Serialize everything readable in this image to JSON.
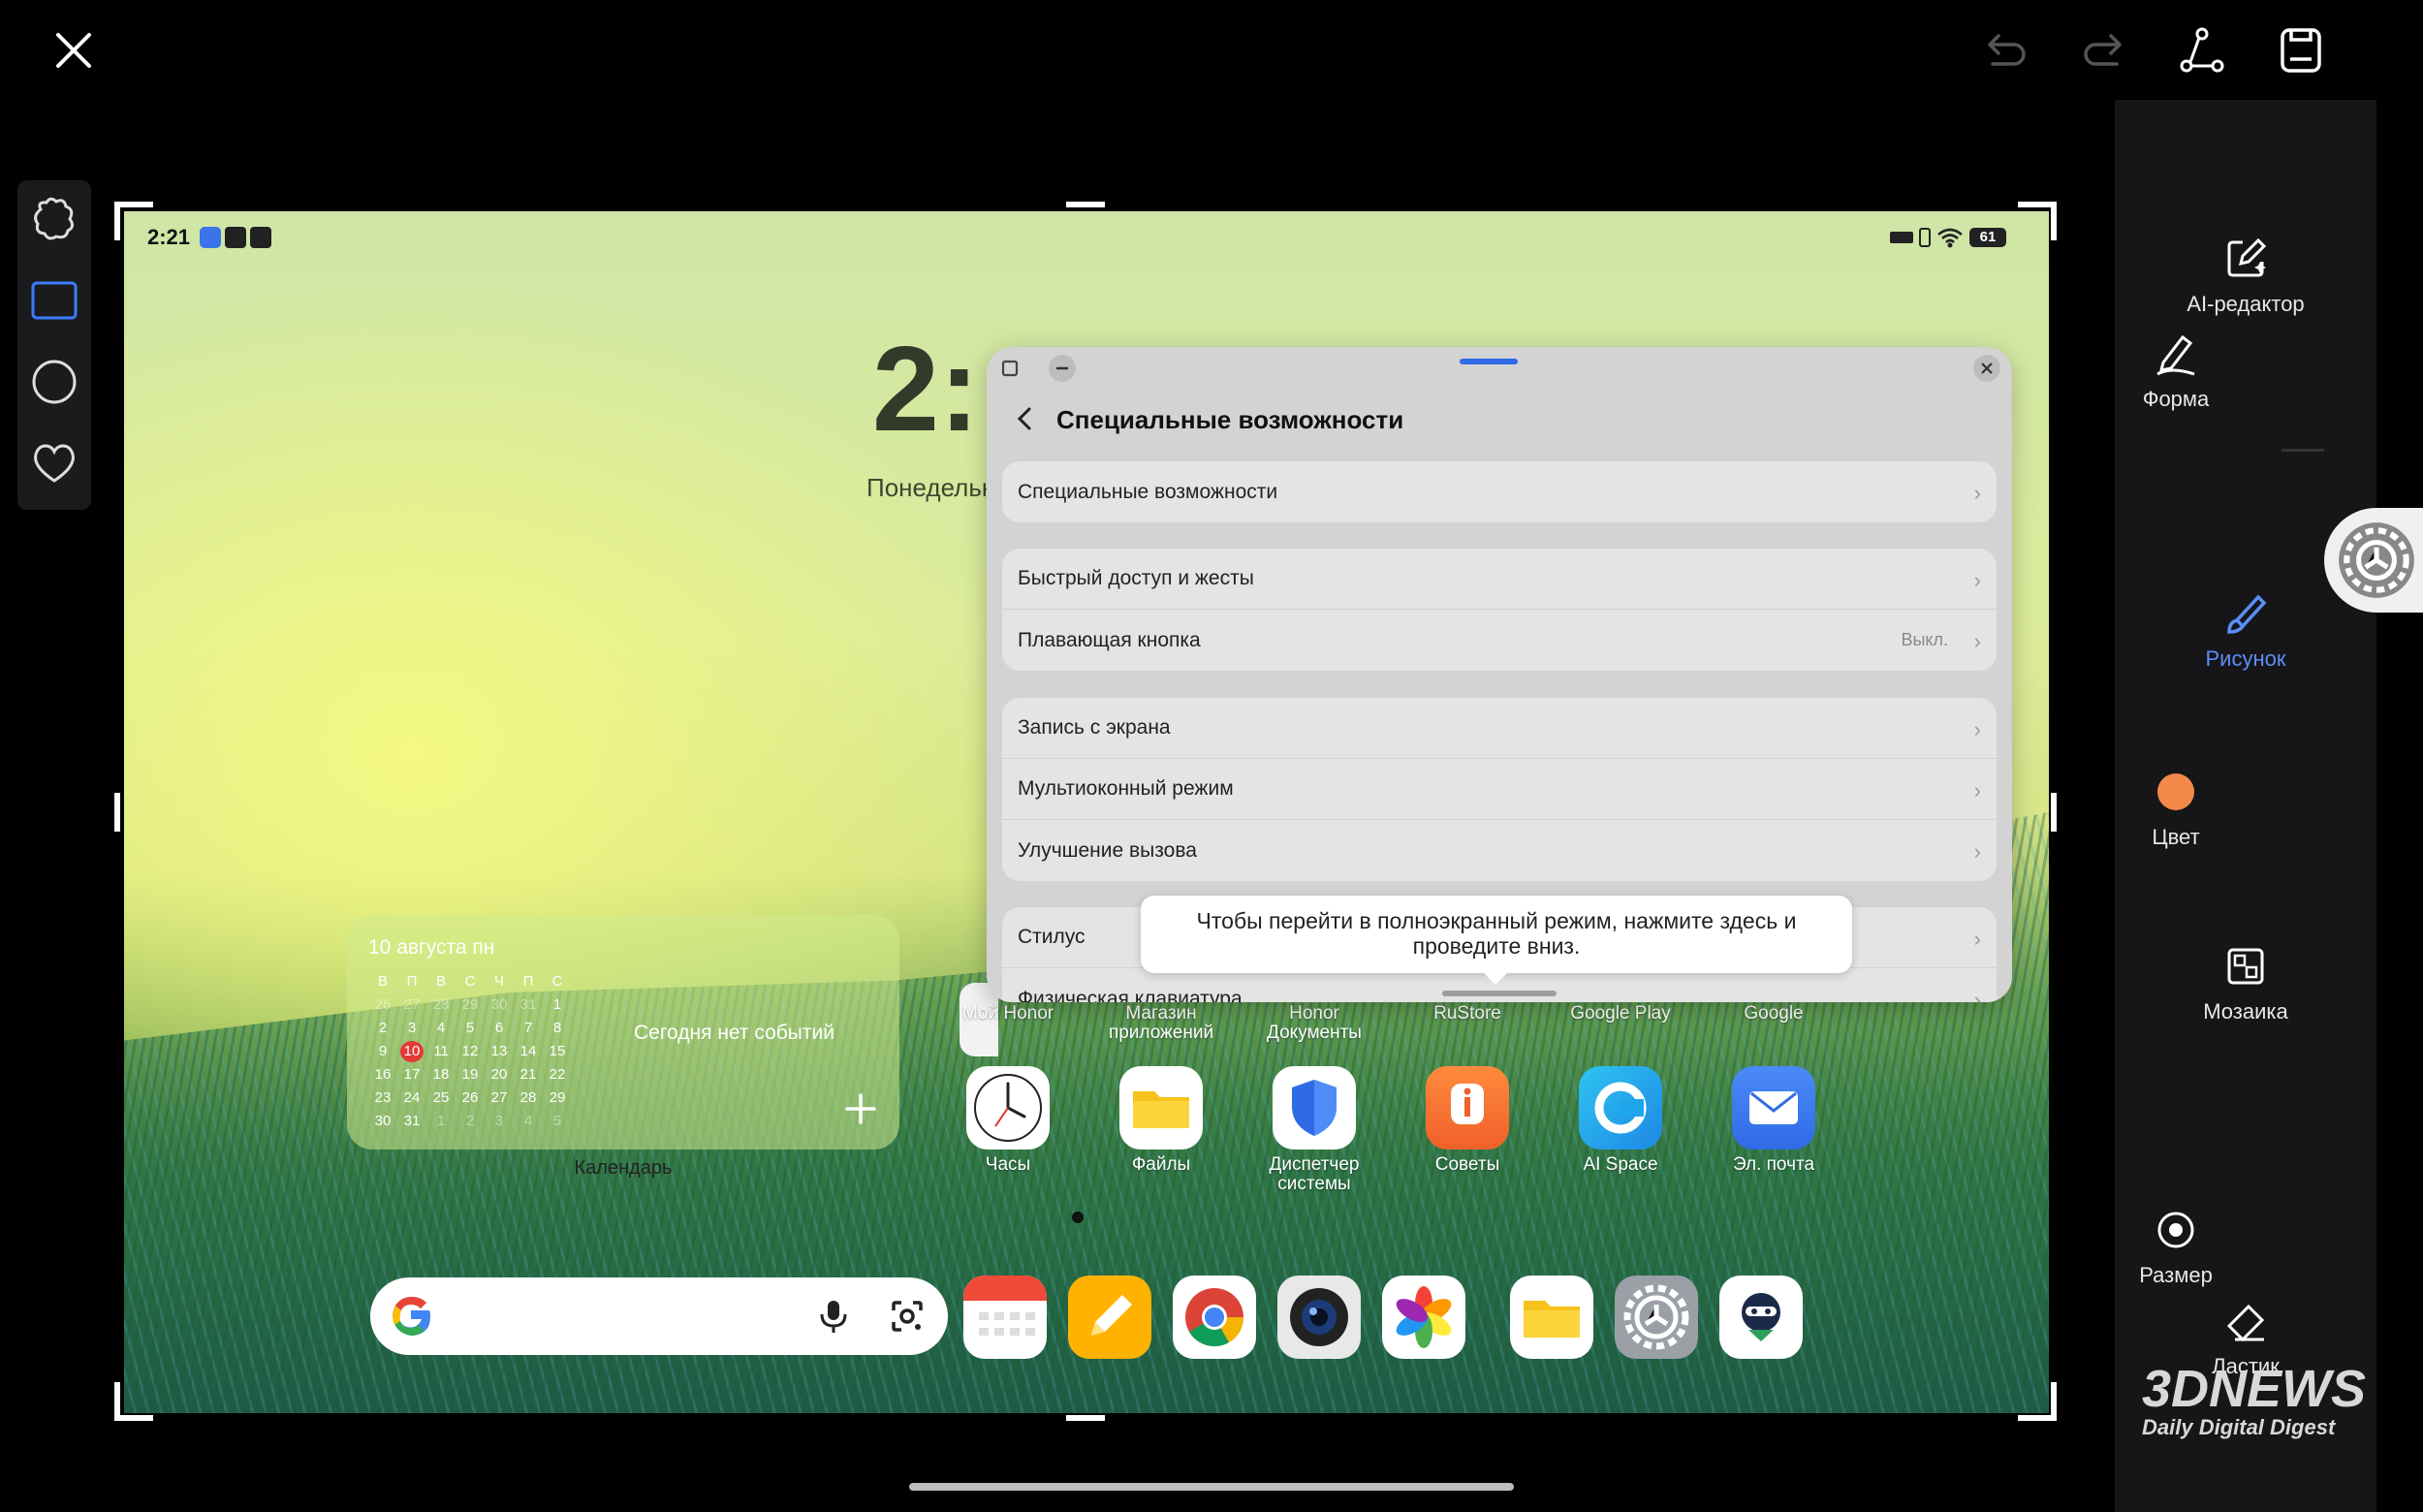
{
  "toolbar": {
    "close": "close-icon",
    "undo": "undo-icon",
    "redo": "redo-icon",
    "path": "path-icon",
    "save": "save-icon"
  },
  "shapes": [
    "puzzle-icon",
    "rectangle-icon",
    "circle-icon",
    "heart-icon"
  ],
  "tools": {
    "ai_editor": "AI-редактор",
    "shape": "Форма",
    "drawing": "Рисунок",
    "color": "Цвет",
    "color_value": "#f5894a",
    "mosaic": "Мозаика",
    "size": "Размер",
    "eraser": "Ластик"
  },
  "accent": "#5b8ef7",
  "status_bar": {
    "time": "2:21",
    "battery": "61"
  },
  "home": {
    "big_clock": "2:",
    "date_partial": "Понедельн"
  },
  "calendar": {
    "header": "10 августа пн",
    "weekdays": [
      "В",
      "П",
      "В",
      "С",
      "Ч",
      "П",
      "С"
    ],
    "weeks": [
      [
        "26",
        "27",
        "28",
        "29",
        "30",
        "31",
        "1"
      ],
      [
        "2",
        "3",
        "4",
        "5",
        "6",
        "7",
        "8"
      ],
      [
        "9",
        "10",
        "11",
        "12",
        "13",
        "14",
        "15"
      ],
      [
        "16",
        "17",
        "18",
        "19",
        "20",
        "21",
        "22"
      ],
      [
        "23",
        "24",
        "25",
        "26",
        "27",
        "28",
        "29"
      ],
      [
        "30",
        "31",
        "1",
        "2",
        "3",
        "4",
        "5"
      ]
    ],
    "no_events": "Сегодня нет событий",
    "label": "Календарь"
  },
  "folders_row": [
    {
      "label": "Мой Honor"
    },
    {
      "label": "Магазин приложений"
    },
    {
      "label": "Honor Документы"
    },
    {
      "label": "RuStore"
    },
    {
      "label": "Google Play"
    },
    {
      "label": "Google"
    }
  ],
  "apps": [
    {
      "label": "Часы"
    },
    {
      "label": "Файлы"
    },
    {
      "label": "Диспетчер системы"
    },
    {
      "label": "Советы"
    },
    {
      "label": "AI Space"
    },
    {
      "label": "Эл. почта"
    }
  ],
  "settings_window": {
    "title": "Специальные возможности",
    "groups": [
      [
        {
          "label": "Специальные возможности"
        }
      ],
      [
        {
          "label": "Быстрый доступ и жесты"
        },
        {
          "label": "Плавающая кнопка",
          "value": "Выкл."
        }
      ],
      [
        {
          "label": "Запись с экрана"
        },
        {
          "label": "Мультиоконный режим"
        },
        {
          "label": "Улучшение вызова"
        }
      ],
      [
        {
          "label": "Стилус"
        },
        {
          "label": "Физическая клавиатура"
        }
      ]
    ]
  },
  "tooltip": "Чтобы перейти в полноэкранный режим, нажмите здесь и проведите вниз.",
  "watermark": {
    "brand": "3DNEWS",
    "tagline": "Daily Digital Digest"
  }
}
